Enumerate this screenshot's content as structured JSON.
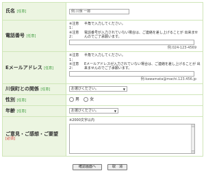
{
  "form": {
    "name": {
      "label": "氏名",
      "tag": "[任意]",
      "placeholder": "例:川俣 一郎"
    },
    "phone": {
      "label": "電話番号",
      "tag": "[任意]",
      "note1_key": "※注意1：",
      "note1": "半角で入力してください。",
      "note2_key": "※注意2：",
      "note2": "電話番号が入力されていない場合は、ご連絡を差し上げることが 出来ませんのでご了承願います。",
      "example": "例:024-123-4569"
    },
    "email": {
      "label": "Eメールアドレス",
      "tag": "[任意]",
      "note1_key": "※注意1：",
      "note1": "半角で入力してください。",
      "note2_key": "※注意2：",
      "note2": "Eメールアドレスが入力されていない場合は、ご連絡を差し上げることが 出来ませんのでご了承願います。",
      "example": "例:kawamata@machi.123.456.jp"
    },
    "relation": {
      "label": "川俣町との関係",
      "tag": "[任意]",
      "selected": "お選びください。"
    },
    "gender": {
      "label": "性別",
      "tag": "[任意]",
      "options": [
        "男",
        "女"
      ]
    },
    "age": {
      "label": "年齢",
      "tag": "[任意]",
      "selected": "お選びください。"
    },
    "opinion": {
      "label": "ご意見・ご感想・ご要望",
      "tag": "[必須]",
      "hint": "※2000文字以内"
    }
  },
  "buttons": {
    "confirm": "確認画面へ",
    "cancel": "取　消"
  }
}
